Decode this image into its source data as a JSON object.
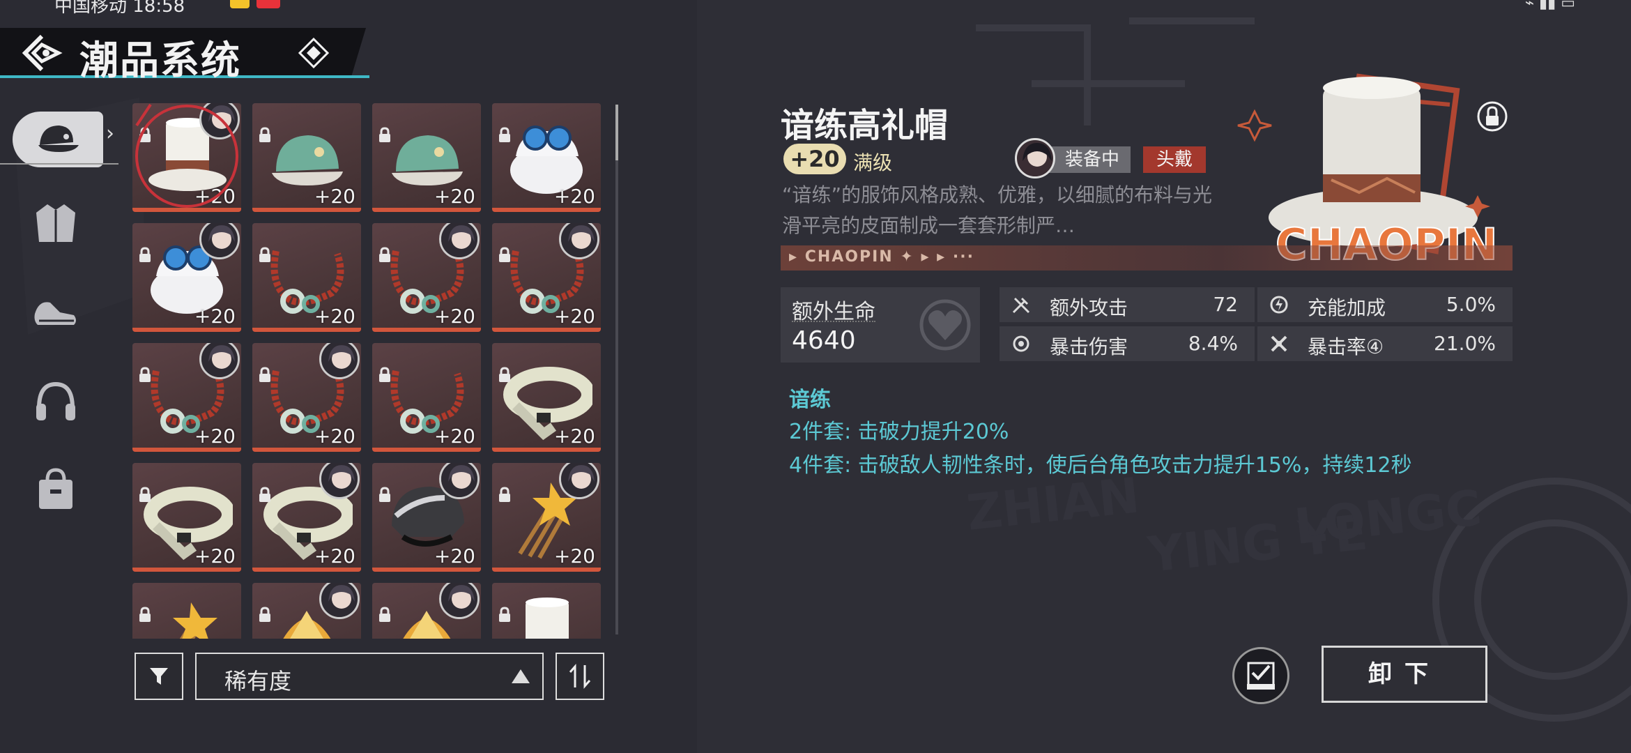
{
  "status_bar": {
    "carrier_time": "中国移动 18:58"
  },
  "header": {
    "title": "潮品系统"
  },
  "categories": [
    {
      "name": "cap",
      "icon": "cap-icon",
      "active": true
    },
    {
      "name": "jacket",
      "icon": "jacket-icon",
      "active": false
    },
    {
      "name": "shoes",
      "icon": "shoes-icon",
      "active": false
    },
    {
      "name": "headphones",
      "icon": "headphones-icon",
      "active": false
    },
    {
      "name": "bag",
      "icon": "bag-icon",
      "active": false
    }
  ],
  "grid": {
    "items": [
      {
        "type": "top-hat",
        "level": "+20",
        "owner": true,
        "selected": true
      },
      {
        "type": "green-cap",
        "level": "+20",
        "owner": false
      },
      {
        "type": "green-cap",
        "level": "+20",
        "owner": false
      },
      {
        "type": "goggle-hat",
        "level": "+20",
        "owner": false
      },
      {
        "type": "goggle-hat",
        "level": "+20",
        "owner": true
      },
      {
        "type": "necklace",
        "level": "+20",
        "owner": false
      },
      {
        "type": "necklace",
        "level": "+20",
        "owner": true
      },
      {
        "type": "necklace",
        "level": "+20",
        "owner": true
      },
      {
        "type": "necklace",
        "level": "+20",
        "owner": true
      },
      {
        "type": "necklace",
        "level": "+20",
        "owner": true
      },
      {
        "type": "necklace",
        "level": "+20",
        "owner": false
      },
      {
        "type": "belt",
        "level": "+20",
        "owner": false
      },
      {
        "type": "belt",
        "level": "+20",
        "owner": false
      },
      {
        "type": "belt",
        "level": "+20",
        "owner": true
      },
      {
        "type": "helmet",
        "level": "+20",
        "owner": true
      },
      {
        "type": "hairpin",
        "level": "+20",
        "owner": true
      },
      {
        "type": "hairpin",
        "level": "",
        "owner": false
      },
      {
        "type": "gold-ornament",
        "level": "",
        "owner": true
      },
      {
        "type": "gold-ornament",
        "level": "",
        "owner": true
      },
      {
        "type": "top-hat",
        "level": "",
        "owner": false
      }
    ]
  },
  "filter": {
    "sort_value": "稀有度"
  },
  "detail": {
    "name": "谙练高礼帽",
    "level": "+20",
    "max_label": "满级",
    "equipped_label": "装备中",
    "slot_label": "头戴",
    "description": "“谙练”的服饰风格成熟、优雅，以细腻的布料与光滑平亮的皮面制成一套套形制严…",
    "banner_text": "▸ CHAOPIN ✦ ▸ ▸ ···",
    "hero_text": "CHAOPIN",
    "main_stat": {
      "label": "额外生命",
      "value": "4640"
    },
    "sub_stats": [
      {
        "label": "额外攻击",
        "value": "72",
        "icon": "attack-icon"
      },
      {
        "label": "充能加成",
        "value": "5.0%",
        "icon": "energy-icon"
      },
      {
        "label": "暴击伤害",
        "value": "8.4%",
        "icon": "crit-dmg-icon"
      },
      {
        "label": "暴击率④",
        "value": "21.0%",
        "icon": "crit-rate-icon"
      }
    ],
    "set": {
      "name": "谙练",
      "two_piece": "2件套: 击破力提升20%",
      "four_piece": "4件套: 击破敌人韧性条时，使后台角色攻击力提升15%，持续12秒"
    }
  },
  "actions": {
    "unequip_label": "卸下"
  },
  "colors": {
    "accent_cyan": "#5cc9d4",
    "tile_bottom": "#d2563c",
    "slot_tag": "#a3382d",
    "level_pill": "#e9ddb1"
  }
}
